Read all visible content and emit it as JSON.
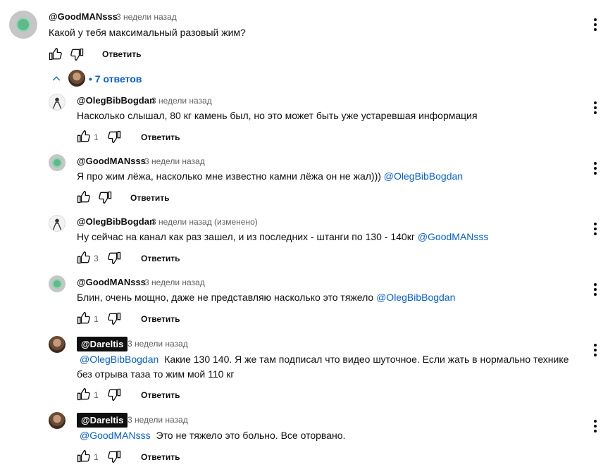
{
  "actions": {
    "reply_label": "Ответить"
  },
  "top_comment": {
    "author": "@GoodMANsss",
    "time": "3 недели назад",
    "text": "Какой у тебя максимальный разовый жим?"
  },
  "replies_toggle": {
    "label": "• 7 ответов"
  },
  "replies": [
    {
      "author": "@OlegBibBogdan",
      "time": "3 недели назад",
      "text": "Насколько слышал, 80 кг камень был, но это может быть уже устаревшая информация",
      "mention": "",
      "likes": "1"
    },
    {
      "author": "@GoodMANsss",
      "time": "3 недели назад",
      "text": "Я про жим лёжа, насколько мне известно камни лёжа он не жал)))",
      "mention": "@OlegBibBogdan",
      "likes": ""
    },
    {
      "author": "@OlegBibBogdan",
      "time": "3 недели назад (изменено)",
      "text": "Ну сейчас на канал как раз зашел, и из последних - штанги по 130 - 140кг",
      "mention": "@GoodMANsss",
      "likes": "3"
    },
    {
      "author": "@GoodMANsss",
      "time": "3 недели назад",
      "text": "Блин, очень мощно, даже не представляю насколько это тяжело",
      "mention": "@OlegBibBogdan",
      "likes": "1"
    },
    {
      "author": "@Dareltis",
      "time": "3 недели назад",
      "mention": "@OlegBibBogdan",
      "text_line1": "Какие 130 140. Я же там подписал что видео шуточное. Если жать в нормально технике",
      "text_line2": "без отрыва таза то жим мой 110 кг",
      "likes": "1"
    },
    {
      "author": "@Dareltis",
      "time": "3 недели назад",
      "mention": "@GoodMANsss",
      "text": "Это не тяжело это больно. Все оторвано.",
      "likes": "1"
    }
  ]
}
